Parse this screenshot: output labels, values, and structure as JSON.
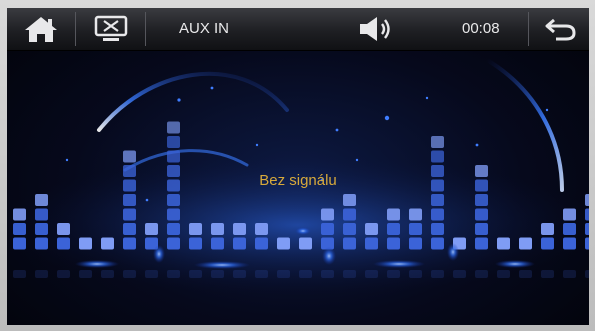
{
  "topbar": {
    "home_icon": "home-icon",
    "screen_off_icon": "screen-off-icon",
    "source_label": "AUX IN",
    "volume_icon": "speaker-icon",
    "time": "00:08",
    "back_icon": "back-arrow-icon"
  },
  "main": {
    "status_text": "Bez signálu"
  },
  "equalizer": {
    "bar_levels": [
      3,
      4,
      2,
      1,
      1,
      7,
      2,
      9,
      2,
      2,
      2,
      2,
      1,
      1,
      3,
      4,
      2,
      3,
      3,
      8,
      1,
      6,
      1,
      1,
      2,
      3,
      4
    ],
    "bar_color": "#3b63d8",
    "peak_color": "#7f9cf5"
  },
  "colors": {
    "status": "#d7a93b",
    "topbar_text": "#e9e9ea",
    "glow": "#2f6df2"
  }
}
